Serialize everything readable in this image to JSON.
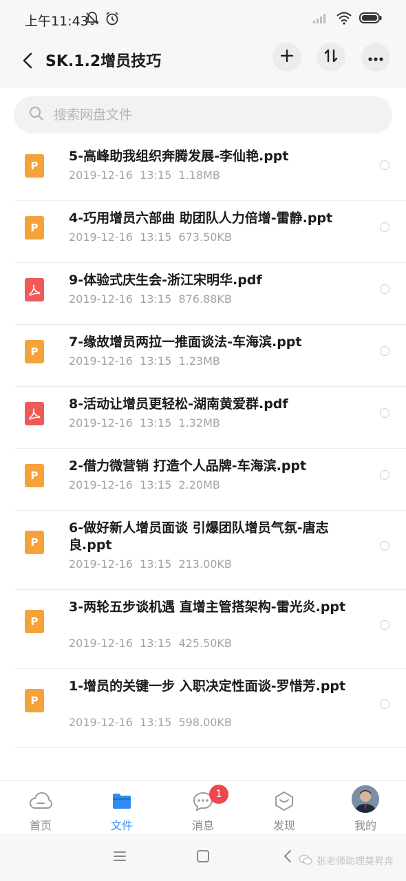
{
  "status_bar": {
    "time": "上午11:43"
  },
  "header": {
    "title": "SK.1.2增员技巧",
    "back_icon": "chevron-left-icon",
    "actions": [
      "plus-icon",
      "sort-icon",
      "more-icon"
    ]
  },
  "search": {
    "placeholder": "搜索网盘文件",
    "value": ""
  },
  "files": [
    {
      "name": "5-高峰助我组织奔腾发展-李仙艳.ppt",
      "date": "2019-12-16",
      "time": "13:15",
      "size": "1.18MB",
      "type": "ppt",
      "icon_letter": "P"
    },
    {
      "name": "4-巧用增员六部曲 助团队人力倍增-雷静.ppt",
      "date": "2019-12-16",
      "time": "13:15",
      "size": "673.50KB",
      "type": "ppt",
      "icon_letter": "P"
    },
    {
      "name": "9-体验式庆生会-浙江宋明华.pdf",
      "date": "2019-12-16",
      "time": "13:15",
      "size": "876.88KB",
      "type": "pdf",
      "icon_letter": ""
    },
    {
      "name": "7-缘故增员两拉一推面谈法-车海滨.ppt",
      "date": "2019-12-16",
      "time": "13:15",
      "size": "1.23MB",
      "type": "ppt",
      "icon_letter": "P"
    },
    {
      "name": "8-活动让增员更轻松-湖南黄爱群.pdf",
      "date": "2019-12-16",
      "time": "13:15",
      "size": "1.32MB",
      "type": "pdf",
      "icon_letter": ""
    },
    {
      "name": "2-借力微营销 打造个人品牌-车海滨.ppt",
      "date": "2019-12-16",
      "time": "13:15",
      "size": "2.20MB",
      "type": "ppt",
      "icon_letter": "P"
    },
    {
      "name": "6-做好新人增员面谈 引爆团队增员气氛-唐志良.ppt",
      "date": "2019-12-16",
      "time": "13:15",
      "size": "213.00KB",
      "type": "ppt",
      "icon_letter": "P"
    },
    {
      "name": "3-两轮五步谈机遇 直增主管搭架构-雷光炎.ppt",
      "date": "2019-12-16",
      "time": "13:15",
      "size": "425.50KB",
      "type": "ppt",
      "icon_letter": "P"
    },
    {
      "name": "1-增员的关键一步 入职决定性面谈-罗惜芳.ppt",
      "date": "2019-12-16",
      "time": "13:15",
      "size": "598.00KB",
      "type": "ppt",
      "icon_letter": "P"
    }
  ],
  "bottom_nav": {
    "items": [
      {
        "label": "首页",
        "icon": "cloud-icon",
        "active": false
      },
      {
        "label": "文件",
        "icon": "folder-icon",
        "active": true
      },
      {
        "label": "消息",
        "icon": "message-icon",
        "active": false,
        "badge": "1"
      },
      {
        "label": "发现",
        "icon": "discover-icon",
        "active": false
      },
      {
        "label": "我的",
        "icon": "avatar",
        "active": false
      }
    ]
  },
  "watermark": "张老师助理莫昇奔",
  "colors": {
    "accent": "#2f8cf2",
    "ppt": "#f6a23b",
    "pdf": "#ee5a5a",
    "badge": "#f0474d"
  }
}
